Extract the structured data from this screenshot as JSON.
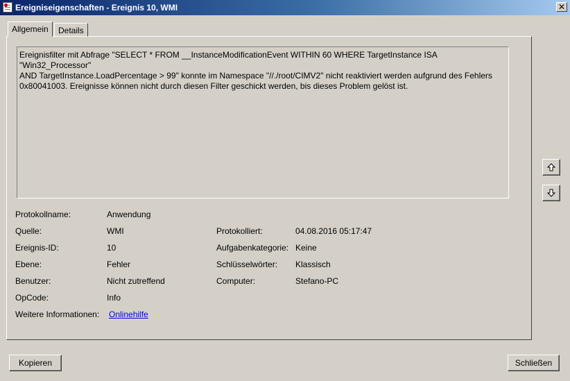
{
  "window": {
    "title": "Ereigniseigenschaften - Ereignis 10, WMI",
    "close_glyph": "✕"
  },
  "tabs": [
    {
      "label": "Allgemein",
      "active": true
    },
    {
      "label": "Details",
      "active": false
    }
  ],
  "message": {
    "line1": "Ereignisfilter mit Abfrage \"SELECT * FROM __InstanceModificationEvent WITHIN 60 WHERE TargetInstance ISA \"Win32_Processor\"",
    "line2": "AND TargetInstance.LoadPercentage > 99\" konnte im Namespace \"//./root/CIMV2\" nicht reaktiviert werden aufgrund des Fehlers",
    "line3": "0x80041003. Ereignisse können nicht durch diesen Filter geschickt werden, bis dieses Problem gelöst ist."
  },
  "fields": {
    "protokollname": {
      "label": "Protokollname:",
      "value": "Anwendung"
    },
    "quelle": {
      "label": "Quelle:",
      "value": "WMI"
    },
    "protokolliert": {
      "label": "Protokolliert:",
      "value": "04.08.2016 05:17:47"
    },
    "ereignis_id": {
      "label": "Ereignis-ID:",
      "value": "10"
    },
    "aufgabenkategorie": {
      "label": "Aufgabenkategorie:",
      "value": "Keine"
    },
    "ebene": {
      "label": "Ebene:",
      "value": "Fehler"
    },
    "schluesselwoerter": {
      "label": "Schlüsselwörter:",
      "value": "Klassisch"
    },
    "benutzer": {
      "label": "Benutzer:",
      "value": "Nicht zutreffend"
    },
    "computer": {
      "label": "Computer:",
      "value": "Stefano-PC"
    },
    "opcode": {
      "label": "OpCode:",
      "value": "Info"
    },
    "weitere": {
      "label": "Weitere Informationen:",
      "value": "Onlinehilfe"
    }
  },
  "icons": {
    "up": "arrow-up-icon",
    "down": "arrow-down-icon"
  },
  "buttons": {
    "copy": "Kopieren",
    "close": "Schließen"
  },
  "colors": {
    "title_gradient_start": "#0a246a",
    "title_gradient_end": "#a6caf0",
    "link": "#0000ee"
  }
}
